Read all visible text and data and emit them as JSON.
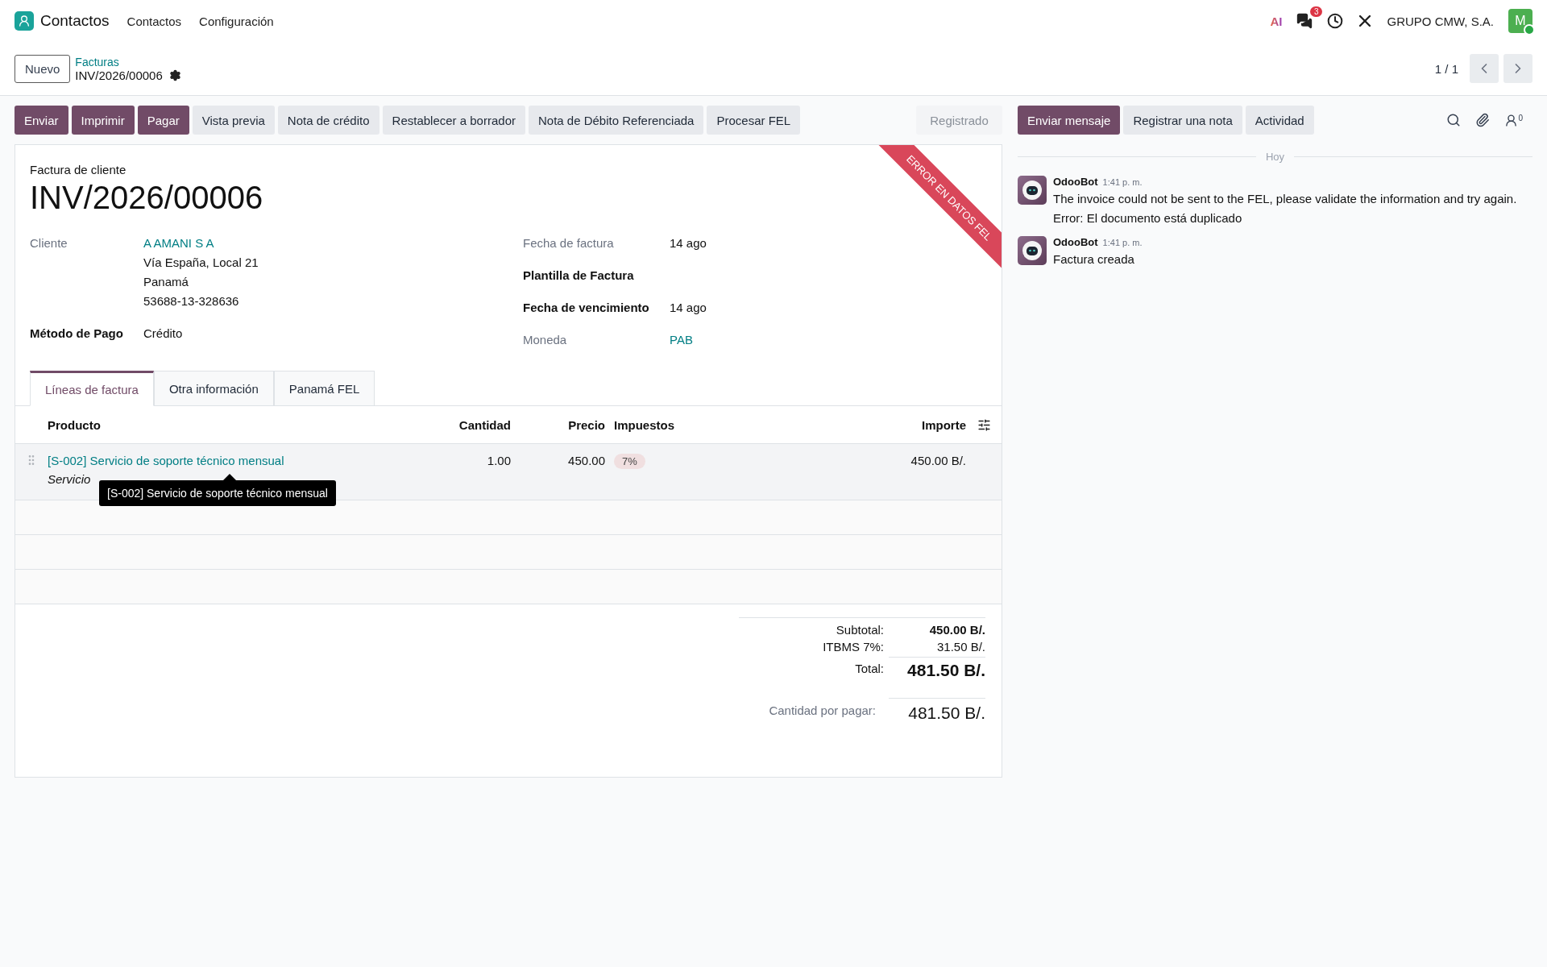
{
  "navbar": {
    "app": "Contactos",
    "menus": [
      "Contactos",
      "Configuración"
    ],
    "ai_label": "AI",
    "message_count": "3",
    "company": "GRUPO CMW, S.A.",
    "avatar_letter": "M",
    "online": true
  },
  "breadcrumb": {
    "new_button": "Nuevo",
    "parent": "Facturas",
    "current": "INV/2026/00006",
    "pager": "1 / 1"
  },
  "actions": [
    {
      "label": "Enviar",
      "kind": "primary"
    },
    {
      "label": "Imprimir",
      "kind": "primary"
    },
    {
      "label": "Pagar",
      "kind": "primary"
    },
    {
      "label": "Vista previa",
      "kind": "secondary"
    },
    {
      "label": "Nota de crédito",
      "kind": "secondary"
    },
    {
      "label": "Restablecer a borrador",
      "kind": "secondary"
    },
    {
      "label": "Nota de Débito Referenciada",
      "kind": "secondary"
    },
    {
      "label": "Procesar FEL",
      "kind": "secondary"
    },
    {
      "label": "Registrado",
      "kind": "status"
    }
  ],
  "form": {
    "subtitle": "Factura de cliente",
    "title": "INV/2026/00006",
    "ribbon": "ERROR EN DATOS FEL",
    "left_fields": [
      {
        "label": "Cliente",
        "required": false,
        "value": "A AMANI S A",
        "link": true,
        "extra_lines": [
          "Vía España, Local 21",
          "Panamá",
          "53688-13-328636"
        ]
      },
      {
        "label": "Método de Pago",
        "required": true,
        "value": "Crédito",
        "link": false
      }
    ],
    "right_fields": [
      {
        "label": "Fecha de factura",
        "required": false,
        "value": "14 ago",
        "link": false
      },
      {
        "label": "Plantilla de Factura",
        "required": true
      },
      {
        "label": "Fecha de vencimiento",
        "required": true,
        "value": "14 ago",
        "link": false
      },
      {
        "label": "Moneda",
        "required": false,
        "value": "PAB",
        "link": true
      }
    ],
    "tabs": [
      {
        "label": "Líneas de factura",
        "selected": true
      },
      {
        "label": "Otra información",
        "selected": false
      },
      {
        "label": "Panamá FEL",
        "selected": false
      }
    ],
    "table": {
      "columns": [
        "Producto",
        "Cantidad",
        "Precio",
        "Impuestos",
        "Importe"
      ],
      "rows": [
        {
          "product": "[S-002] Servicio de soporte técnico mensual",
          "description": "Servicio",
          "quantity": "1.00",
          "price": "450.00",
          "tax": "7%",
          "amount": "450.00 B/."
        }
      ]
    },
    "tooltip": "[S-002] Servicio de soporte técnico mensual",
    "totals": [
      {
        "label": "Subtotal:",
        "value": "450.00 B/.",
        "kind": "bold"
      },
      {
        "label": "ITBMS 7%:",
        "value": "31.50 B/.",
        "kind": "normal"
      },
      {
        "label": "Total:",
        "value": "481.50 B/.",
        "kind": "total"
      }
    ],
    "amount_due": {
      "label": "Cantidad por pagar:",
      "value": "481.50 B/."
    }
  },
  "chatter": {
    "actions": [
      {
        "label": "Enviar mensaje",
        "kind": "primary"
      },
      {
        "label": "Registrar una nota",
        "kind": "secondary"
      },
      {
        "label": "Actividad",
        "kind": "secondary"
      }
    ],
    "followers": "0",
    "separator": "Hoy",
    "messages": [
      {
        "author": "OdooBot",
        "time": "1:41 p. m.",
        "body": "The invoice could not be sent to the FEL, please validate the information and try again. Error: El documento está duplicado"
      },
      {
        "author": "OdooBot",
        "time": "1:41 p. m.",
        "body": "Factura creada"
      }
    ]
  }
}
